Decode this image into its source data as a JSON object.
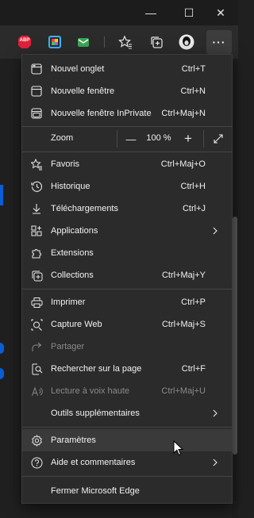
{
  "window": {
    "minimize_label": "—",
    "maximize_label": "☐",
    "close_label": "✕"
  },
  "toolbar": {
    "abp_label": "ABP",
    "more_label": "···"
  },
  "menu": {
    "new_tab": {
      "label": "Nouvel onglet",
      "shortcut": "Ctrl+T"
    },
    "new_window": {
      "label": "Nouvelle fenêtre",
      "shortcut": "Ctrl+N"
    },
    "new_inprivate": {
      "label": "Nouvelle fenêtre InPrivate",
      "shortcut": "Ctrl+Maj+N"
    },
    "zoom": {
      "label": "Zoom",
      "value": "100 %",
      "minus": "—",
      "plus": "+"
    },
    "favorites": {
      "label": "Favoris",
      "shortcut": "Ctrl+Maj+O"
    },
    "history": {
      "label": "Historique",
      "shortcut": "Ctrl+H"
    },
    "downloads": {
      "label": "Téléchargements",
      "shortcut": "Ctrl+J"
    },
    "apps": {
      "label": "Applications"
    },
    "extensions": {
      "label": "Extensions"
    },
    "collections": {
      "label": "Collections",
      "shortcut": "Ctrl+Maj+Y"
    },
    "print": {
      "label": "Imprimer",
      "shortcut": "Ctrl+P"
    },
    "web_capture": {
      "label": "Capture Web",
      "shortcut": "Ctrl+Maj+S"
    },
    "share": {
      "label": "Partager"
    },
    "find": {
      "label": "Rechercher sur la page",
      "shortcut": "Ctrl+F"
    },
    "read_aloud": {
      "label": "Lecture à voix haute",
      "shortcut": "Ctrl+Maj+U"
    },
    "more_tools": {
      "label": "Outils supplémentaires"
    },
    "settings": {
      "label": "Paramètres"
    },
    "help": {
      "label": "Aide et commentaires"
    },
    "close_edge": {
      "label": "Fermer Microsoft Edge"
    }
  },
  "colors": {
    "menu_bg": "#2b2b2b",
    "hover_bg": "#3a3a3a",
    "accent": "#0a5fd6",
    "abp_red": "#e2203a",
    "disabled_text": "#8a8a8a"
  }
}
